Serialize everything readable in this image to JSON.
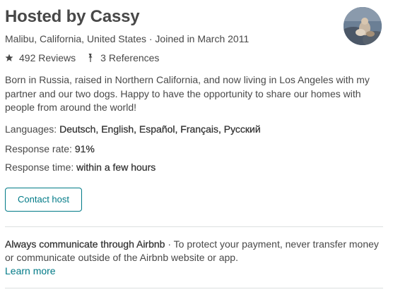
{
  "host": {
    "title": "Hosted by Cassy",
    "location_joined": "Malibu, California, United States · Joined in March 2011",
    "reviews_label": "492 Reviews",
    "references_label": "3 References"
  },
  "bio": "Born in Russia, raised in Northern California, and now living in Los Angeles with my partner and our two dogs. Happy to have the opportunity to share our homes with people from around the world!",
  "details": {
    "languages_label": "Languages:",
    "languages_value": "Deutsch, English, Español, Français, Русский",
    "response_rate_label": "Response rate:",
    "response_rate_value": "91%",
    "response_time_label": "Response time:",
    "response_time_value": "within a few hours"
  },
  "contact_button": "Contact host",
  "notice": {
    "heading": "Always communicate through Airbnb",
    "separator": " · ",
    "body": "To protect your payment, never transfer money or communicate outside of the Airbnb website or app.",
    "learn_more": "Learn more"
  },
  "colors": {
    "text": "#484848",
    "accent": "#007a87",
    "divider": "#dce0e0"
  },
  "icons": {
    "reviews": "star-icon",
    "references": "references-icon"
  }
}
